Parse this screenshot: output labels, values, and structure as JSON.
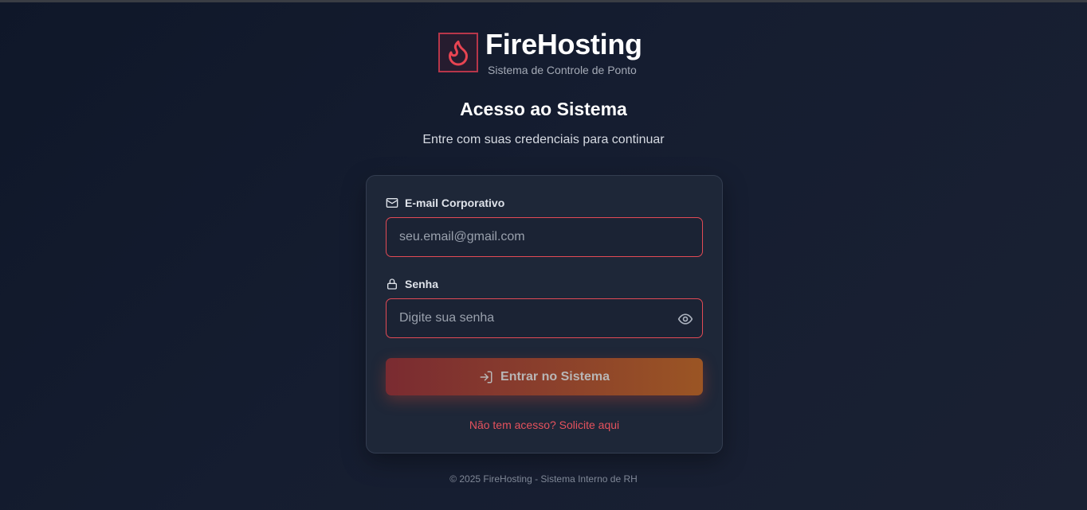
{
  "brand": {
    "name": "FireHosting",
    "subtitle": "Sistema de Controle de Ponto",
    "logo_icon": "flame-icon",
    "accent_color": "#e24a55"
  },
  "heading": {
    "title": "Acesso ao Sistema",
    "subtitle": "Entre com suas credenciais para continuar"
  },
  "form": {
    "email": {
      "label": "E-mail Corporativo",
      "icon": "mail-icon",
      "placeholder": "seu.email@gmail.com",
      "value": ""
    },
    "password": {
      "label": "Senha",
      "icon": "lock-icon",
      "placeholder": "Digite sua senha",
      "value": "",
      "toggle_icon": "eye-icon"
    },
    "submit": {
      "label": "Entrar no Sistema",
      "icon": "log-in-icon"
    },
    "request_access_link": "Não tem acesso? Solicite aqui"
  },
  "footer": {
    "text": "© 2025 FireHosting - Sistema Interno de RH"
  }
}
